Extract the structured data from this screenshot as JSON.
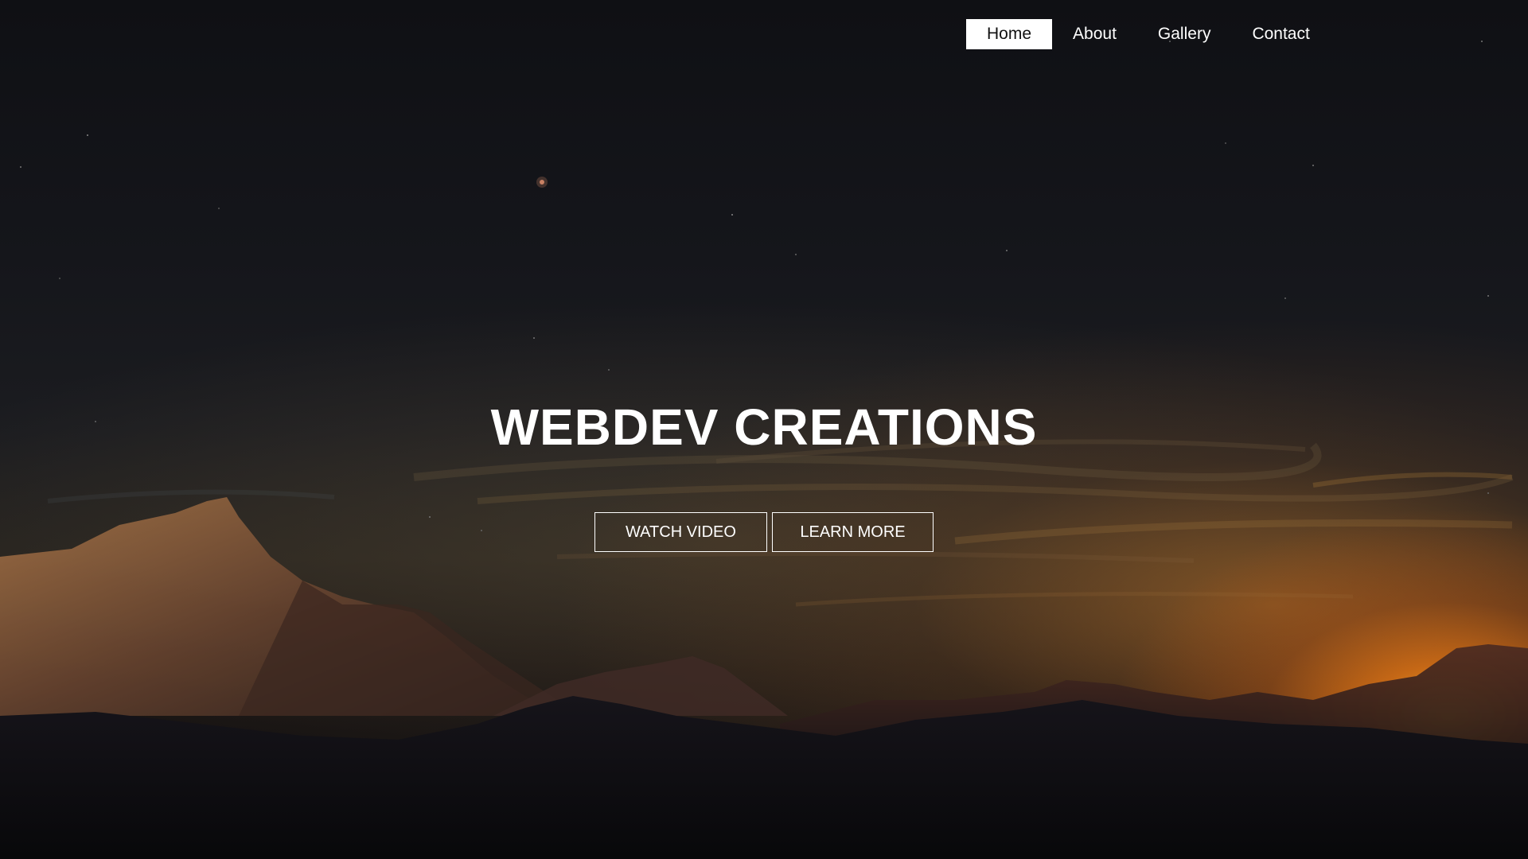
{
  "nav": {
    "items": [
      {
        "label": "Home",
        "active": true
      },
      {
        "label": "About",
        "active": false
      },
      {
        "label": "Gallery",
        "active": false
      },
      {
        "label": "Contact",
        "active": false
      }
    ]
  },
  "hero": {
    "title": "WEBDEV CREATIONS",
    "watch_label": "WATCH VIDEO",
    "learn_label": "LEARN MORE"
  },
  "colors": {
    "text": "#ffffff",
    "active_nav_bg": "#ffffff",
    "sky_dark": "#121317",
    "sun": "#f0a030"
  },
  "background": {
    "scene": "mountain-sunset"
  }
}
